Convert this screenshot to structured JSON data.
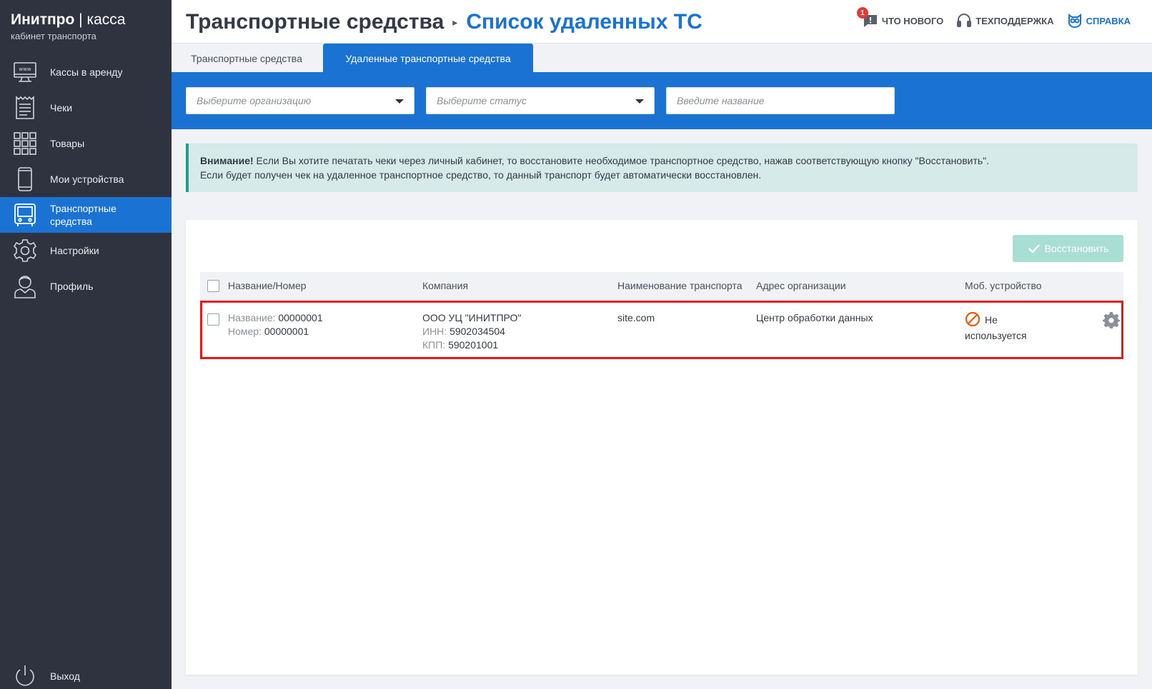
{
  "brand": {
    "name_bold": "Инитпро",
    "name_sep": " | ",
    "name_light": "касса",
    "subtitle": "кабинет транспорта"
  },
  "sidebar": {
    "items": [
      {
        "label": "Кассы в аренду",
        "icon": "www-monitor-icon"
      },
      {
        "label": "Чеки",
        "icon": "receipt-icon"
      },
      {
        "label": "Товары",
        "icon": "grid-icon"
      },
      {
        "label": "Мои устройства",
        "icon": "phone-icon"
      },
      {
        "label": "Транспортные средства",
        "icon": "bus-icon",
        "active": true
      },
      {
        "label": "Настройки",
        "icon": "gear-icon"
      },
      {
        "label": "Профиль",
        "icon": "user-icon"
      }
    ],
    "logout": "Выход"
  },
  "header": {
    "breadcrumb_root": "Транспортные средства",
    "breadcrumb_sep": "▸",
    "breadcrumb_current": "Список удаленных ТС",
    "whats_new": "ЧТО НОВОГО",
    "whats_new_badge": "1",
    "support": "ТЕХПОДДЕРЖКА",
    "help": "СПРАВКА"
  },
  "tabs": [
    {
      "label": "Транспортные средства",
      "active": false
    },
    {
      "label": "Удаленные транспортные средства",
      "active": true
    }
  ],
  "filters": {
    "org_placeholder": "Выберите организацию",
    "status_placeholder": "Выберите статус",
    "name_placeholder": "Введите название"
  },
  "alert": {
    "strong": "Внимание!",
    "line1": " Если Вы хотите печатать чеки через личный кабинет, то восстановите необходимое транспортное средство, нажав соответствующую кнопку \"Восстановить\".",
    "line2": "Если будет получен чек на удаленное транспортное средство, то данный транспорт будет автоматически восстановлен."
  },
  "toolbar": {
    "restore_label": "Восстановить"
  },
  "table": {
    "columns": [
      "Название/Номер",
      "Компания",
      "Наименование транспорта",
      "Адрес организации",
      "Моб. устройство"
    ],
    "rows": [
      {
        "name_label": "Название:",
        "name_value": "00000001",
        "number_label": "Номер:",
        "number_value": "00000001",
        "company": "ООО УЦ \"ИНИТПРО\"",
        "inn_label": "ИНН:",
        "inn_value": "5902034504",
        "kpp_label": "КПП:",
        "kpp_value": "590201001",
        "transport_name": "site.com",
        "org_address": "Центр обработки данных",
        "device_status_1": "Не",
        "device_status_2": "используется"
      }
    ]
  },
  "colors": {
    "sidebar_bg": "#2f3340",
    "accent": "#1a73d2",
    "alert_bg": "#d6eaea",
    "highlight": "#e31a1a",
    "restore_btn": "#a9ded5",
    "status_icon": "#e8590c"
  }
}
